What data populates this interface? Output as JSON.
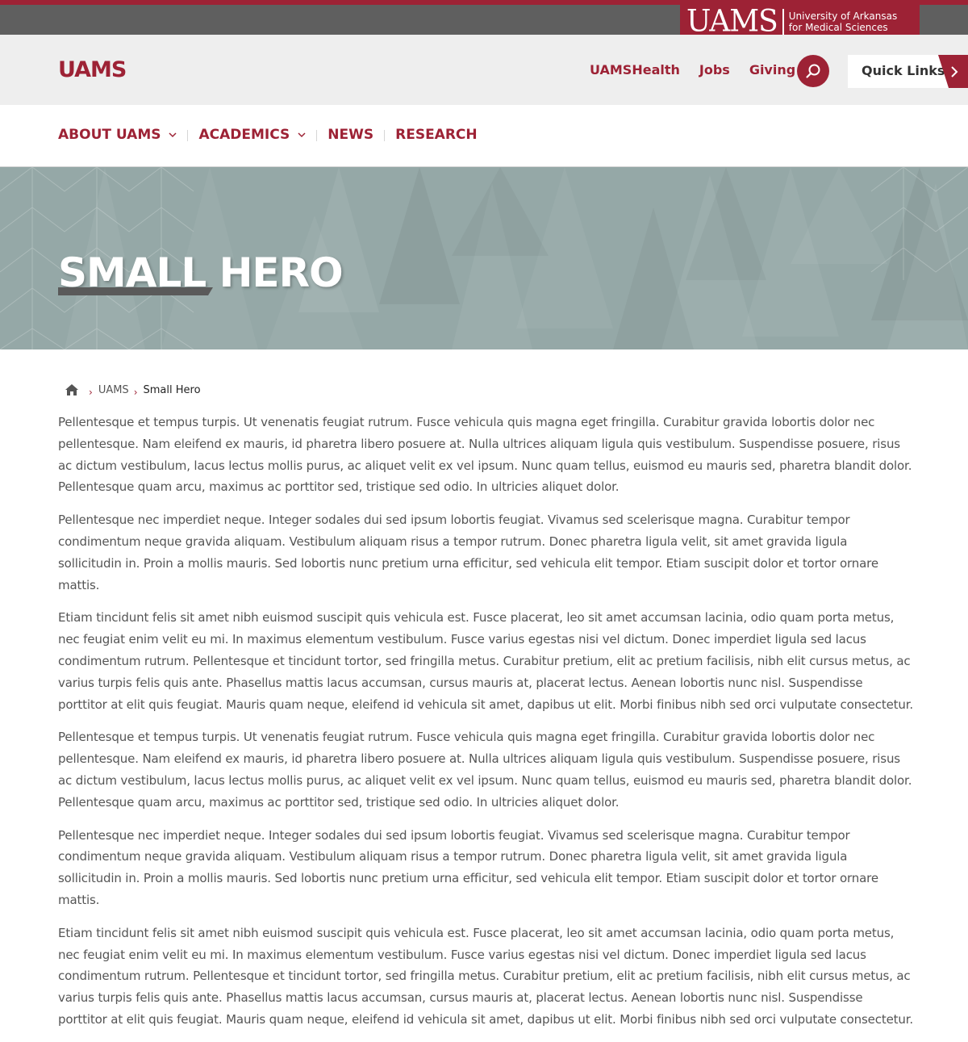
{
  "brand": {
    "wordmark": "UAMS",
    "subtitle_line1": "University of Arkansas",
    "subtitle_line2": "for Medical Sciences",
    "accent_color": "#9d2235"
  },
  "header": {
    "site_title": "UAMS",
    "util_links": [
      "UAMSHealth",
      "Jobs",
      "Giving"
    ],
    "search_icon": "search-icon",
    "quick_links_label": "Quick Links"
  },
  "nav": {
    "items": [
      {
        "label": "ABOUT UAMS",
        "has_dropdown": true
      },
      {
        "label": "ACADEMICS",
        "has_dropdown": true
      },
      {
        "label": "NEWS",
        "has_dropdown": false
      },
      {
        "label": "RESEARCH",
        "has_dropdown": false
      }
    ]
  },
  "hero": {
    "title": "SMALL HERO",
    "background_color": "#95a8a7"
  },
  "breadcrumb": {
    "home_icon": "home-icon",
    "items": [
      "UAMS",
      "Small Hero"
    ]
  },
  "content": {
    "paragraphs": [
      "Pellentesque et tempus turpis. Ut venenatis feugiat rutrum. Fusce vehicula quis magna eget fringilla. Curabitur gravida lobortis dolor nec pellentesque. Nam eleifend ex mauris, id pharetra libero posuere at. Nulla ultrices aliquam ligula quis vestibulum. Suspendisse posuere, risus ac dictum vestibulum, lacus lectus mollis purus, ac aliquet velit ex vel ipsum. Nunc quam tellus, euismod eu mauris sed, pharetra blandit dolor. Pellentesque quam arcu, maximus ac porttitor sed, tristique sed odio. In ultricies aliquet dolor.",
      "Pellentesque nec imperdiet neque. Integer sodales dui sed ipsum lobortis feugiat. Vivamus sed scelerisque magna. Curabitur tempor condimentum neque gravida aliquam. Vestibulum aliquam risus a tempor rutrum. Donec pharetra ligula velit, sit amet gravida ligula sollicitudin in. Proin a mollis mauris. Sed lobortis nunc pretium urna efficitur, sed vehicula elit tempor. Etiam suscipit dolor et tortor ornare mattis.",
      "Etiam tincidunt felis sit amet nibh euismod suscipit quis vehicula est. Fusce placerat, leo sit amet accumsan lacinia, odio quam porta metus, nec feugiat enim velit eu mi. In maximus elementum vestibulum. Fusce varius egestas nisi vel dictum. Donec imperdiet ligula sed lacus condimentum rutrum. Pellentesque et tincidunt tortor, sed fringilla metus. Curabitur pretium, elit ac pretium facilisis, nibh elit cursus metus, ac varius turpis felis quis ante. Phasellus mattis lacus accumsan, cursus mauris at, placerat lectus. Aenean lobortis nunc nisl. Suspendisse porttitor at elit quis feugiat. Mauris quam neque, eleifend id vehicula sit amet, dapibus ut elit. Morbi finibus nibh sed orci vulputate consectetur.",
      "Pellentesque et tempus turpis. Ut venenatis feugiat rutrum. Fusce vehicula quis magna eget fringilla. Curabitur gravida lobortis dolor nec pellentesque. Nam eleifend ex mauris, id pharetra libero posuere at. Nulla ultrices aliquam ligula quis vestibulum. Suspendisse posuere, risus ac dictum vestibulum, lacus lectus mollis purus, ac aliquet velit ex vel ipsum. Nunc quam tellus, euismod eu mauris sed, pharetra blandit dolor. Pellentesque quam arcu, maximus ac porttitor sed, tristique sed odio. In ultricies aliquet dolor.",
      "Pellentesque nec imperdiet neque. Integer sodales dui sed ipsum lobortis feugiat. Vivamus sed scelerisque magna. Curabitur tempor condimentum neque gravida aliquam. Vestibulum aliquam risus a tempor rutrum. Donec pharetra ligula velit, sit amet gravida ligula sollicitudin in. Proin a mollis mauris. Sed lobortis nunc pretium urna efficitur, sed vehicula elit tempor. Etiam suscipit dolor et tortor ornare mattis.",
      "Etiam tincidunt felis sit amet nibh euismod suscipit quis vehicula est. Fusce placerat, leo sit amet accumsan lacinia, odio quam porta metus, nec feugiat enim velit eu mi. In maximus elementum vestibulum. Fusce varius egestas nisi vel dictum. Donec imperdiet ligula sed lacus condimentum rutrum. Pellentesque et tincidunt tortor, sed fringilla metus. Curabitur pretium, elit ac pretium facilisis, nibh elit cursus metus, ac varius turpis felis quis ante. Phasellus mattis lacus accumsan, cursus mauris at, placerat lectus. Aenean lobortis nunc nisl. Suspendisse porttitor at elit quis feugiat. Mauris quam neque, eleifend id vehicula sit amet, dapibus ut elit. Morbi finibus nibh sed orci vulputate consectetur."
    ]
  }
}
